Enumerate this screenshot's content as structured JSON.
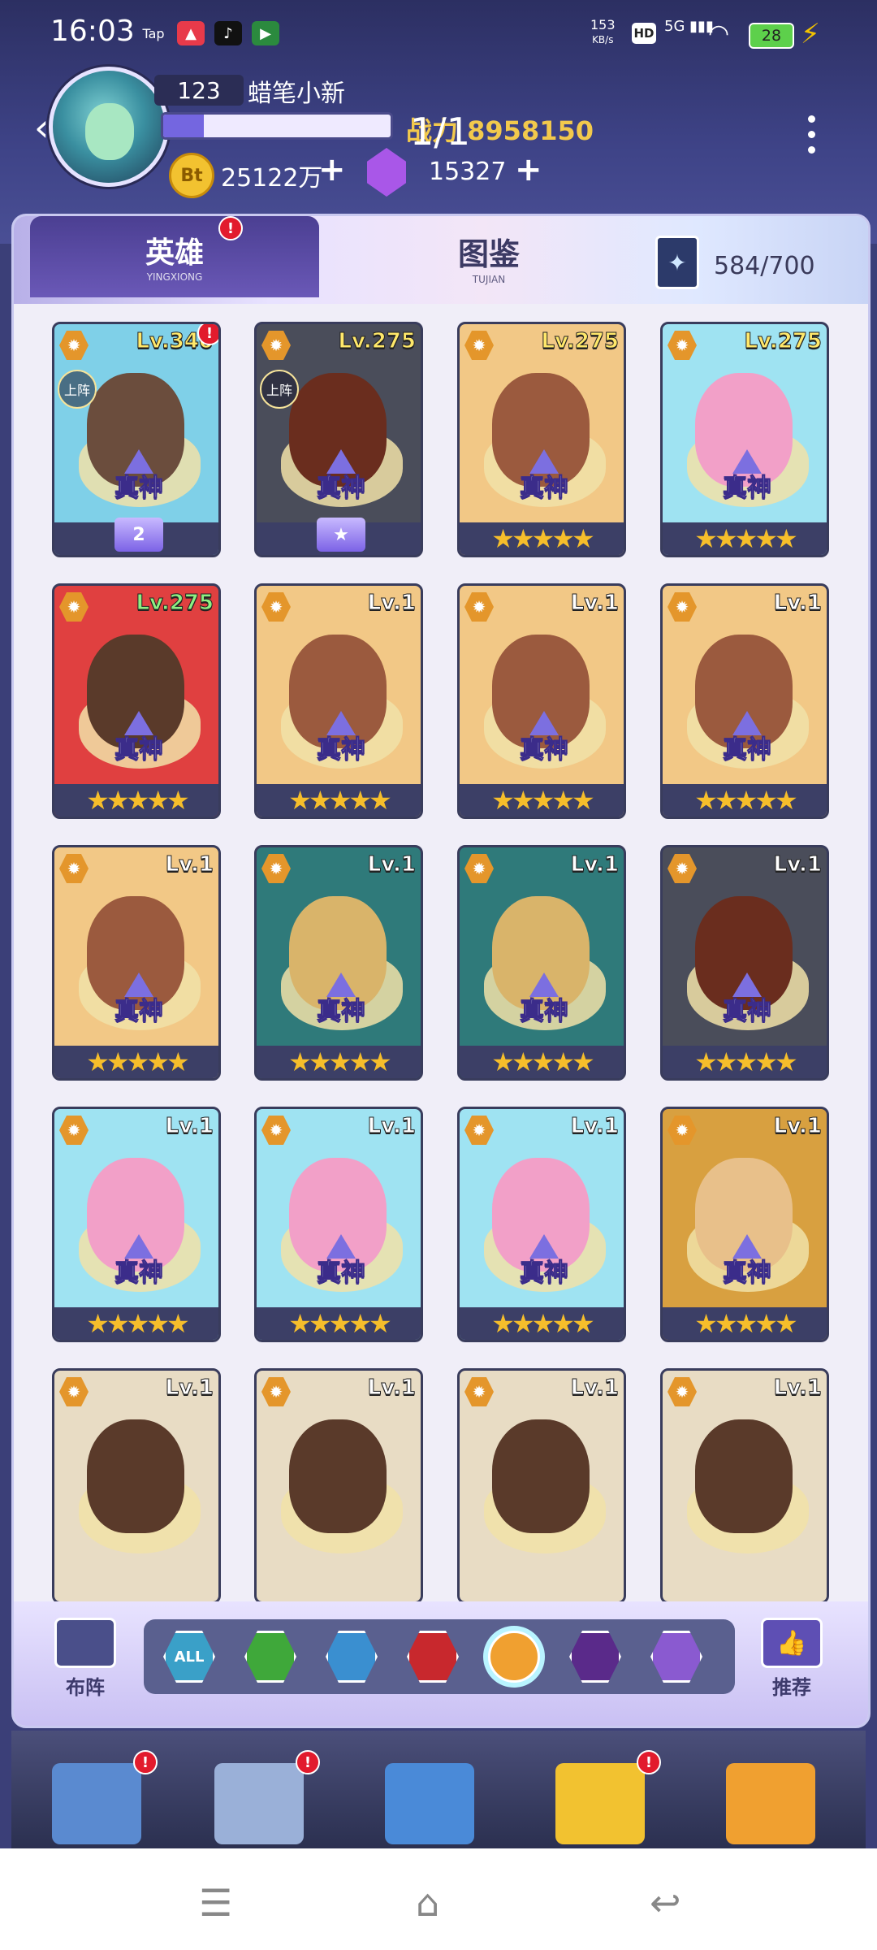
{
  "status": {
    "time": "16:03",
    "app_icons": [
      "Tap",
      "xiaohongshu-icon",
      "tiktok-icon",
      "play-icon"
    ],
    "net_speed_value": "153",
    "net_speed_unit": "KB/s",
    "hd": "HD",
    "signal": "5G",
    "battery": "28"
  },
  "player": {
    "level": "123",
    "name": "蜡笔小新",
    "exp_fraction": 0.18,
    "power": "战力 8958150",
    "page": "1/1",
    "coins": "25122万",
    "coin_symbol": "Bt",
    "gems": "15327",
    "add": "+"
  },
  "tabs": {
    "hero": {
      "label": "英雄",
      "sub": "YINGXIONG",
      "badge": "!"
    },
    "book": {
      "label": "图鉴",
      "sub": "TUJIAN"
    },
    "count": "584/700"
  },
  "heroes": [
    {
      "lv": "Lv.340",
      "up": "上阵",
      "rank": "真神",
      "medal": "2",
      "badge": "!",
      "skin": "#6b4d3d",
      "bg": "#7fd0e8"
    },
    {
      "lv": "Lv.275",
      "up": "上阵",
      "rank": "真神",
      "medal": "★",
      "skin": "#6a2d1e",
      "bg": "#4a4d5a"
    },
    {
      "lv": "Lv.275",
      "rank": "真神",
      "stars": "★★★★★",
      "skin": "#9b5a3e",
      "bg": "#f2c886"
    },
    {
      "lv": "Lv.275",
      "rank": "真神",
      "stars": "★★★★★",
      "skin": "#f2a0c8",
      "bg": "#9fe3f2"
    },
    {
      "lv": "Lv.275",
      "rank": "真神",
      "stars": "★★★★★",
      "skin": "#5a3a2a",
      "bg": "#e04040"
    },
    {
      "lv": "Lv.1",
      "rank": "真神",
      "stars": "★★★★★",
      "skin": "#9b5a3e",
      "bg": "#f2c886"
    },
    {
      "lv": "Lv.1",
      "rank": "真神",
      "stars": "★★★★★",
      "skin": "#9b5a3e",
      "bg": "#f2c886"
    },
    {
      "lv": "Lv.1",
      "rank": "真神",
      "stars": "★★★★★",
      "skin": "#9b5a3e",
      "bg": "#f2c886"
    },
    {
      "lv": "Lv.1",
      "rank": "真神",
      "stars": "★★★★★",
      "skin": "#9b5a3e",
      "bg": "#f2c886"
    },
    {
      "lv": "Lv.1",
      "rank": "真神",
      "stars": "★★★★★",
      "skin": "#d9b46a",
      "bg": "#2f7a7a"
    },
    {
      "lv": "Lv.1",
      "rank": "真神",
      "stars": "★★★★★",
      "skin": "#d9b46a",
      "bg": "#2f7a7a"
    },
    {
      "lv": "Lv.1",
      "rank": "真神",
      "stars": "★★★★★",
      "skin": "#6a2d1e",
      "bg": "#4a4d5a"
    },
    {
      "lv": "Lv.1",
      "rank": "真神",
      "stars": "★★★★★",
      "skin": "#f2a0c8",
      "bg": "#9fe3f2"
    },
    {
      "lv": "Lv.1",
      "rank": "真神",
      "stars": "★★★★★",
      "skin": "#f2a0c8",
      "bg": "#9fe3f2"
    },
    {
      "lv": "Lv.1",
      "rank": "真神",
      "stars": "★★★★★",
      "skin": "#f2a0c8",
      "bg": "#9fe3f2"
    },
    {
      "lv": "Lv.1",
      "rank": "真神",
      "stars": "★★★★★",
      "skin": "#e8c08a",
      "bg": "#d8a040"
    },
    {
      "lv": "Lv.1",
      "skin": "#5a3a2a",
      "bg": "#e8dcc4"
    },
    {
      "lv": "Lv.1",
      "skin": "#5a3a2a",
      "bg": "#e8dcc4"
    },
    {
      "lv": "Lv.1",
      "skin": "#5a3a2a",
      "bg": "#e8dcc4"
    },
    {
      "lv": "Lv.1",
      "skin": "#5a3a2a",
      "bg": "#e8dcc4"
    }
  ],
  "bottom": {
    "formation": "布阵",
    "recommend": "推荐",
    "filters": [
      {
        "name": "all",
        "label": "ALL",
        "color": "#3aa0c8"
      },
      {
        "name": "nature",
        "label": "",
        "color": "#3fa83a"
      },
      {
        "name": "water",
        "label": "",
        "color": "#3a8fd0"
      },
      {
        "name": "fire",
        "label": "",
        "color": "#c8282d"
      },
      {
        "name": "light",
        "label": "",
        "color": "#f0a030",
        "selected": true
      },
      {
        "name": "dark",
        "label": "",
        "color": "#5a2a8a"
      },
      {
        "name": "void",
        "label": "",
        "color": "#8a5ad0"
      }
    ]
  },
  "nav": [
    {
      "name": "city",
      "color": "#5a8ad0",
      "badge": "!"
    },
    {
      "name": "castle",
      "color": "#9ab0d8",
      "badge": "!"
    },
    {
      "name": "pet",
      "color": "#4a8ad8"
    },
    {
      "name": "hero",
      "color": "#f2c230",
      "badge": "!"
    },
    {
      "name": "shop",
      "color": "#f0a030"
    }
  ]
}
